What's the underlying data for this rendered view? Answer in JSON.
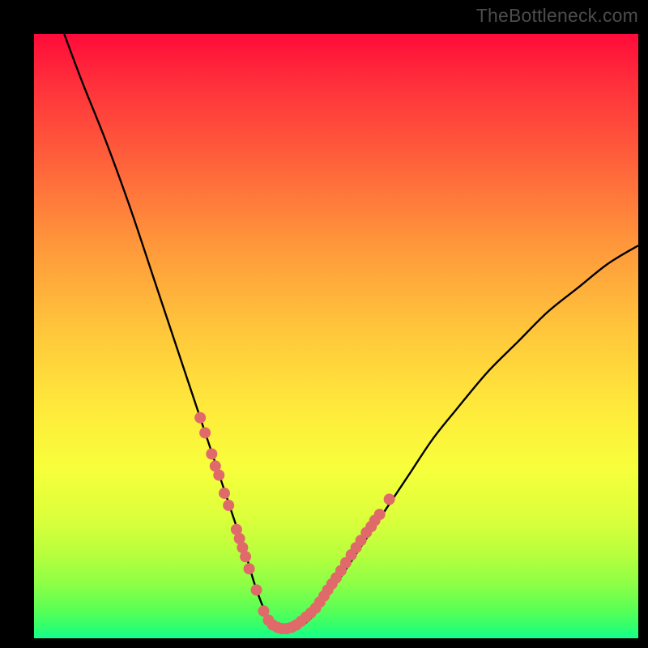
{
  "watermark": "TheBottleneck.com",
  "colors": {
    "background": "#000000",
    "curve_stroke": "#000000",
    "marker_fill": "#e06a6a",
    "gradient_top": "#ff0b3a",
    "gradient_bottom": "#14ff8c"
  },
  "chart_data": {
    "type": "line",
    "title": "",
    "xlabel": "",
    "ylabel": "",
    "xlim": [
      0,
      100
    ],
    "ylim": [
      0,
      100
    ],
    "note": "Axes are unlabeled in the image; values are estimated as percentage of plot width/height (0–100). y=0 is the green bottom edge, y=100 is the red top edge.",
    "series": [
      {
        "name": "bottleneck-curve",
        "x": [
          5,
          8,
          12,
          16,
          20,
          24,
          27,
          29,
          31,
          33,
          35,
          36.5,
          38,
          39.5,
          41,
          43,
          46,
          50,
          54,
          58,
          62,
          66,
          70,
          75,
          80,
          85,
          90,
          95,
          100
        ],
        "y": [
          100,
          92,
          82,
          71,
          59,
          47,
          38,
          32,
          26,
          20,
          14,
          9,
          5,
          2.5,
          1.5,
          1.5,
          3.5,
          9,
          15,
          21,
          27,
          33,
          38,
          44,
          49,
          54,
          58,
          62,
          65
        ]
      }
    ],
    "markers": [
      {
        "name": "left-cluster",
        "x": [
          27.5,
          28.3,
          29.4,
          30.0,
          30.6,
          31.5,
          32.2,
          33.5,
          34.0,
          34.5,
          35.0,
          35.6,
          36.8
        ],
        "y": [
          36.5,
          34.0,
          30.5,
          28.5,
          27.0,
          24.0,
          22.0,
          18.0,
          16.5,
          15.0,
          13.5,
          11.5,
          8.0
        ]
      },
      {
        "name": "bottom-cluster",
        "x": [
          38.0,
          38.8,
          39.5,
          40.3,
          41.0,
          41.8,
          42.6,
          43.4,
          44.2,
          45.0,
          45.8,
          46.6
        ],
        "y": [
          4.5,
          3.0,
          2.2,
          1.8,
          1.6,
          1.6,
          1.8,
          2.2,
          2.8,
          3.5,
          4.2,
          5.0
        ]
      },
      {
        "name": "right-cluster",
        "x": [
          47.3,
          48.0,
          48.6,
          49.3,
          50.0,
          50.8,
          51.6,
          52.5,
          53.3,
          54.1,
          55.0,
          55.8,
          56.4,
          57.2,
          58.8
        ],
        "y": [
          6.0,
          7.0,
          8.0,
          9.0,
          10.0,
          11.2,
          12.5,
          13.8,
          15.0,
          16.2,
          17.5,
          18.5,
          19.5,
          20.5,
          23.0
        ]
      }
    ]
  }
}
